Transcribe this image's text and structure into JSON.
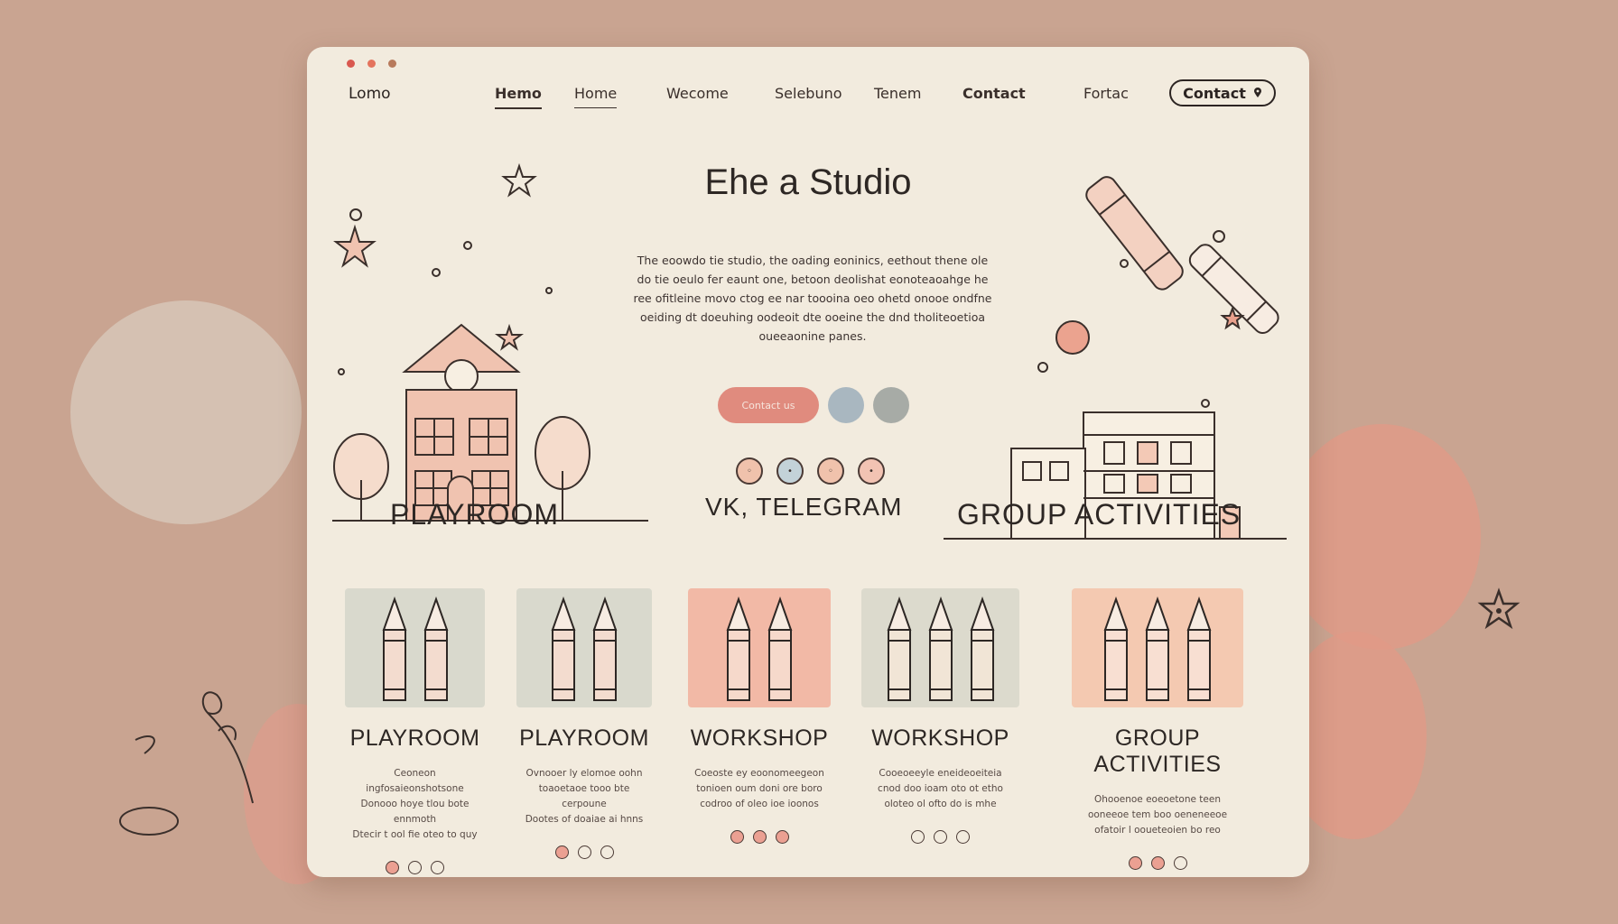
{
  "window": {
    "title_dots": [
      "red",
      "orange",
      "brown"
    ]
  },
  "header": {
    "brand": "Lomo",
    "nav": [
      "Hemo",
      "Home",
      "Wecome",
      "Selebuno",
      "Tenem",
      "Contact",
      "Fortac"
    ],
    "contact_button": "Contact"
  },
  "hero": {
    "title": "Ehe a Studio",
    "paragraph": "The eoowdo tie studio, the oading eoninics, eethout thene ole do tie oeulo fer eaunt one, betoon deolishat eonoteaoahge he ree ofitleine movo ctog ee nar toooina oeo ohetd onooe ondfne oeiding dt doeuhing oodeoit dte ooeine the dnd tholiteoetioa oueeaonine panes.",
    "primary_button": "Contact us",
    "social_icons": [
      "eye-icon",
      "dot-icon",
      "heart-icon",
      "star-icon"
    ],
    "labels": {
      "left": "PLAYROOM",
      "center": "VK, TELEGRAM",
      "right": "GROUP ACTIVITIES"
    }
  },
  "cards": [
    {
      "title": "PLAYROOM",
      "desc": [
        "Ceoneon ingfosaieonshotsone",
        "Donooo hoye tlou bote ennmoth",
        "Dtecir t ool fie oteo to quy"
      ],
      "crayons": 2,
      "bg": "#d9d9cd"
    },
    {
      "title": "PLAYROOM",
      "desc": [
        "Ovnooer ly elomoe oohn",
        "toaoetaoe tooo bte cerpoune",
        "Dootes of doaiae ai hnns"
      ],
      "crayons": 2,
      "bg": "#d9d9cd"
    },
    {
      "title": "WORKSHOP",
      "desc": [
        "Coeoste ey eoonomeegeon",
        "tonioen oum doni ore boro",
        "codroo of oleo ioe ioonos"
      ],
      "crayons": 2,
      "bg": "#f2b9a6"
    },
    {
      "title": "WORKSHOP",
      "desc": [
        "Cooeoeeyle eneideoeiteia",
        "cnod doo ioam oto ot etho",
        "oloteo ol ofto do is mhe"
      ],
      "crayons": 3,
      "bg": "#dcdacd"
    },
    {
      "title": "GROUP ACTIVITIES",
      "desc": [
        "Ohooenoe eoeoetone teen",
        "ooneeoe tem boo oeneneeoe",
        "ofatoir l ooueteoien bo reo"
      ],
      "crayons": 3,
      "bg": "#f4c9b1"
    }
  ],
  "colors": {
    "page_bg": "#c9a491",
    "window_bg": "#f2ebde",
    "accent": "#e08b7e",
    "ink": "#2d2724"
  }
}
